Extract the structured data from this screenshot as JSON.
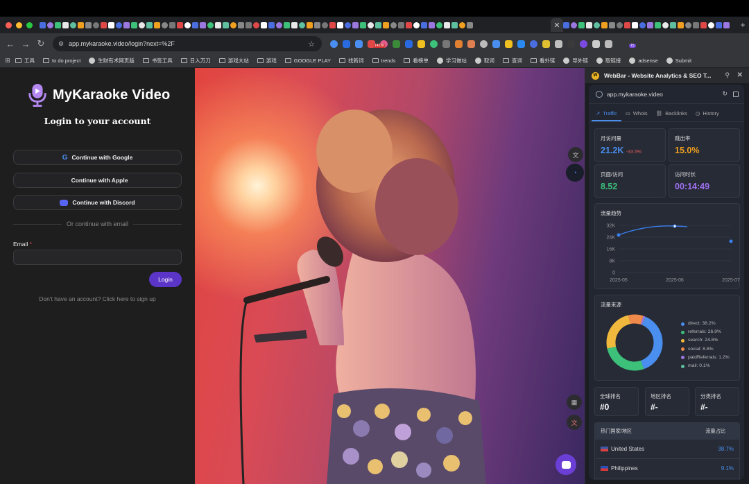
{
  "browser": {
    "url": "app.mykaraoke.video/login?next=%2F",
    "bookmarks": [
      "工具",
      "to do project",
      "生财有术网页版",
      "书签工具",
      "日入万刀",
      "游戏大站",
      "游戏",
      "GOOGLE PLAY",
      "找新词",
      "trends",
      "看榜单",
      "学习做站",
      "取词",
      "查词",
      "看外链",
      "导外链",
      "取链接",
      "adsense",
      "Submit"
    ],
    "ext_badges": {
      "b1": "1422K",
      "b2": "15"
    }
  },
  "login": {
    "brand_name": "MyKaraoke Video",
    "title": "Login to your account",
    "google_label": "Continue with Google",
    "apple_label": "Continue with Apple",
    "discord_label": "Continue with Discord",
    "divider_text": "Or continue with email",
    "email_label": "Email",
    "required_mark": "*",
    "login_button": "Login",
    "signup_text": "Don't have an account? Click here to sign up"
  },
  "webbar": {
    "title": "WebBar - Website Analytics & SEO T...",
    "site": "app.mykaraoke.video",
    "tabs": [
      "Traffic",
      "Whois",
      "Backlinks",
      "History"
    ],
    "stats": {
      "visits_label": "月访问量",
      "visits_value": "21.2K",
      "visits_delta": "-33.5%",
      "bounce_label": "跳出率",
      "bounce_value": "15.0%",
      "pages_label": "页面/访问",
      "pages_value": "8.52",
      "duration_label": "访问时长",
      "duration_value": "00:14:49"
    },
    "trend_title": "流量趋势",
    "source_title": "流量来源",
    "rank": {
      "global_label": "全球排名",
      "global_value": "#0",
      "region_label": "地区排名",
      "region_value": "#-",
      "category_label": "分类排名",
      "category_value": "#-"
    },
    "countries_title": "热门国家/地区",
    "share_label": "流量占比",
    "countries": [
      {
        "name": "United States",
        "pct": "38.7%"
      },
      {
        "name": "Philippines",
        "pct": "9.1%"
      }
    ],
    "colors": {
      "visits": "#4a8ff0",
      "bounce": "#f0a020",
      "pages": "#3cc07a",
      "duration": "#a070f0"
    }
  },
  "chart_data": [
    {
      "type": "line",
      "x": [
        "2025-05",
        "2025-06",
        "2025-07"
      ],
      "series": [
        {
          "values": [
            25500,
            31500,
            21200
          ]
        }
      ],
      "ylim": [
        0,
        32000
      ],
      "yticks": [
        "32K",
        "24K",
        "16K",
        "8K",
        "0"
      ],
      "grid": true
    },
    {
      "type": "pie",
      "categories": [
        "direct",
        "referrals",
        "search",
        "social",
        "paidReferrals",
        "mail"
      ],
      "values": [
        38.2,
        26.9,
        24.8,
        8.6,
        1.2,
        0.1
      ],
      "labels": [
        "direct: 38.2%",
        "referrals: 26.9%",
        "search: 24.8%",
        "social: 8.6%",
        "paidReferrals: 1.2%",
        "mail: 0.1%"
      ],
      "colors": [
        "#4a8ff0",
        "#3cc07a",
        "#f0b83c",
        "#f08a4a",
        "#9b78e0",
        "#5fc0a0"
      ]
    }
  ]
}
